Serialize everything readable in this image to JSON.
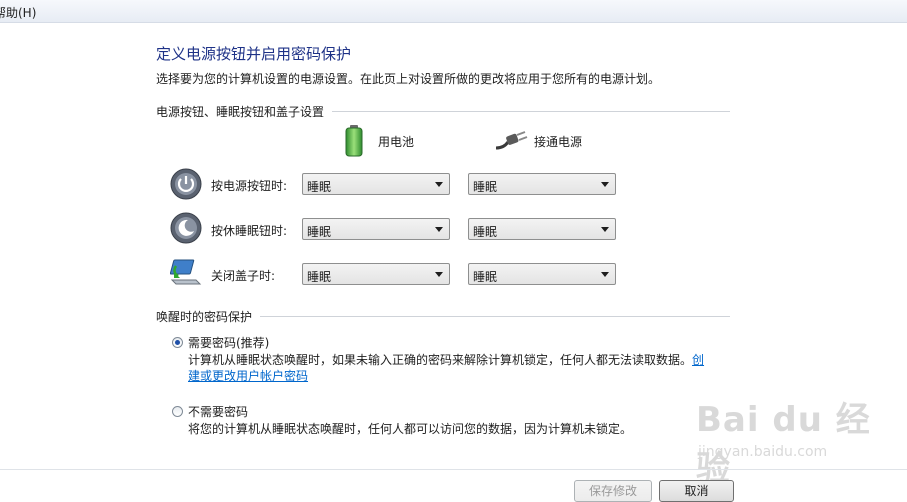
{
  "menu": {
    "help_label": "帮助(H)"
  },
  "header": {
    "title": "定义电源按钮并启用密码保护",
    "description": "选择要为您的计算机设置的电源设置。在此页上对设置所做的更改将应用于您所有的电源计划。"
  },
  "power_section": {
    "heading": "电源按钮、睡眠按钮和盖子设置",
    "col_battery": "用电池",
    "col_plugged": "接通电源",
    "rows": [
      {
        "label": "按电源按钮时:",
        "battery": "睡眠",
        "plugged": "睡眠"
      },
      {
        "label": "按休睡眠钮时:",
        "battery": "睡眠",
        "plugged": "睡眠"
      },
      {
        "label": "关闭盖子时:",
        "battery": "睡眠",
        "plugged": "睡眠"
      }
    ]
  },
  "password_section": {
    "heading": "唤醒时的密码保护",
    "opt_require": {
      "label": "需要密码(推荐)",
      "desc": "计算机从睡眠状态唤醒时，如果未输入正确的密码来解除计算机锁定，任何人都无法读取数据。",
      "link_part1": "创",
      "link_part2": "建或更改用户帐户密码"
    },
    "opt_none": {
      "label": "不需要密码",
      "desc": "将您的计算机从睡眠状态唤醒时，任何人都可以访问您的数据，因为计算机未锁定。"
    }
  },
  "footer": {
    "save_label": "保存修改",
    "cancel_label": "取消"
  },
  "watermark": {
    "logo": "Bai du 经验",
    "site": "jingyan.baidu.com"
  },
  "colors": {
    "title": "#1e3287",
    "link": "#0066cc"
  }
}
